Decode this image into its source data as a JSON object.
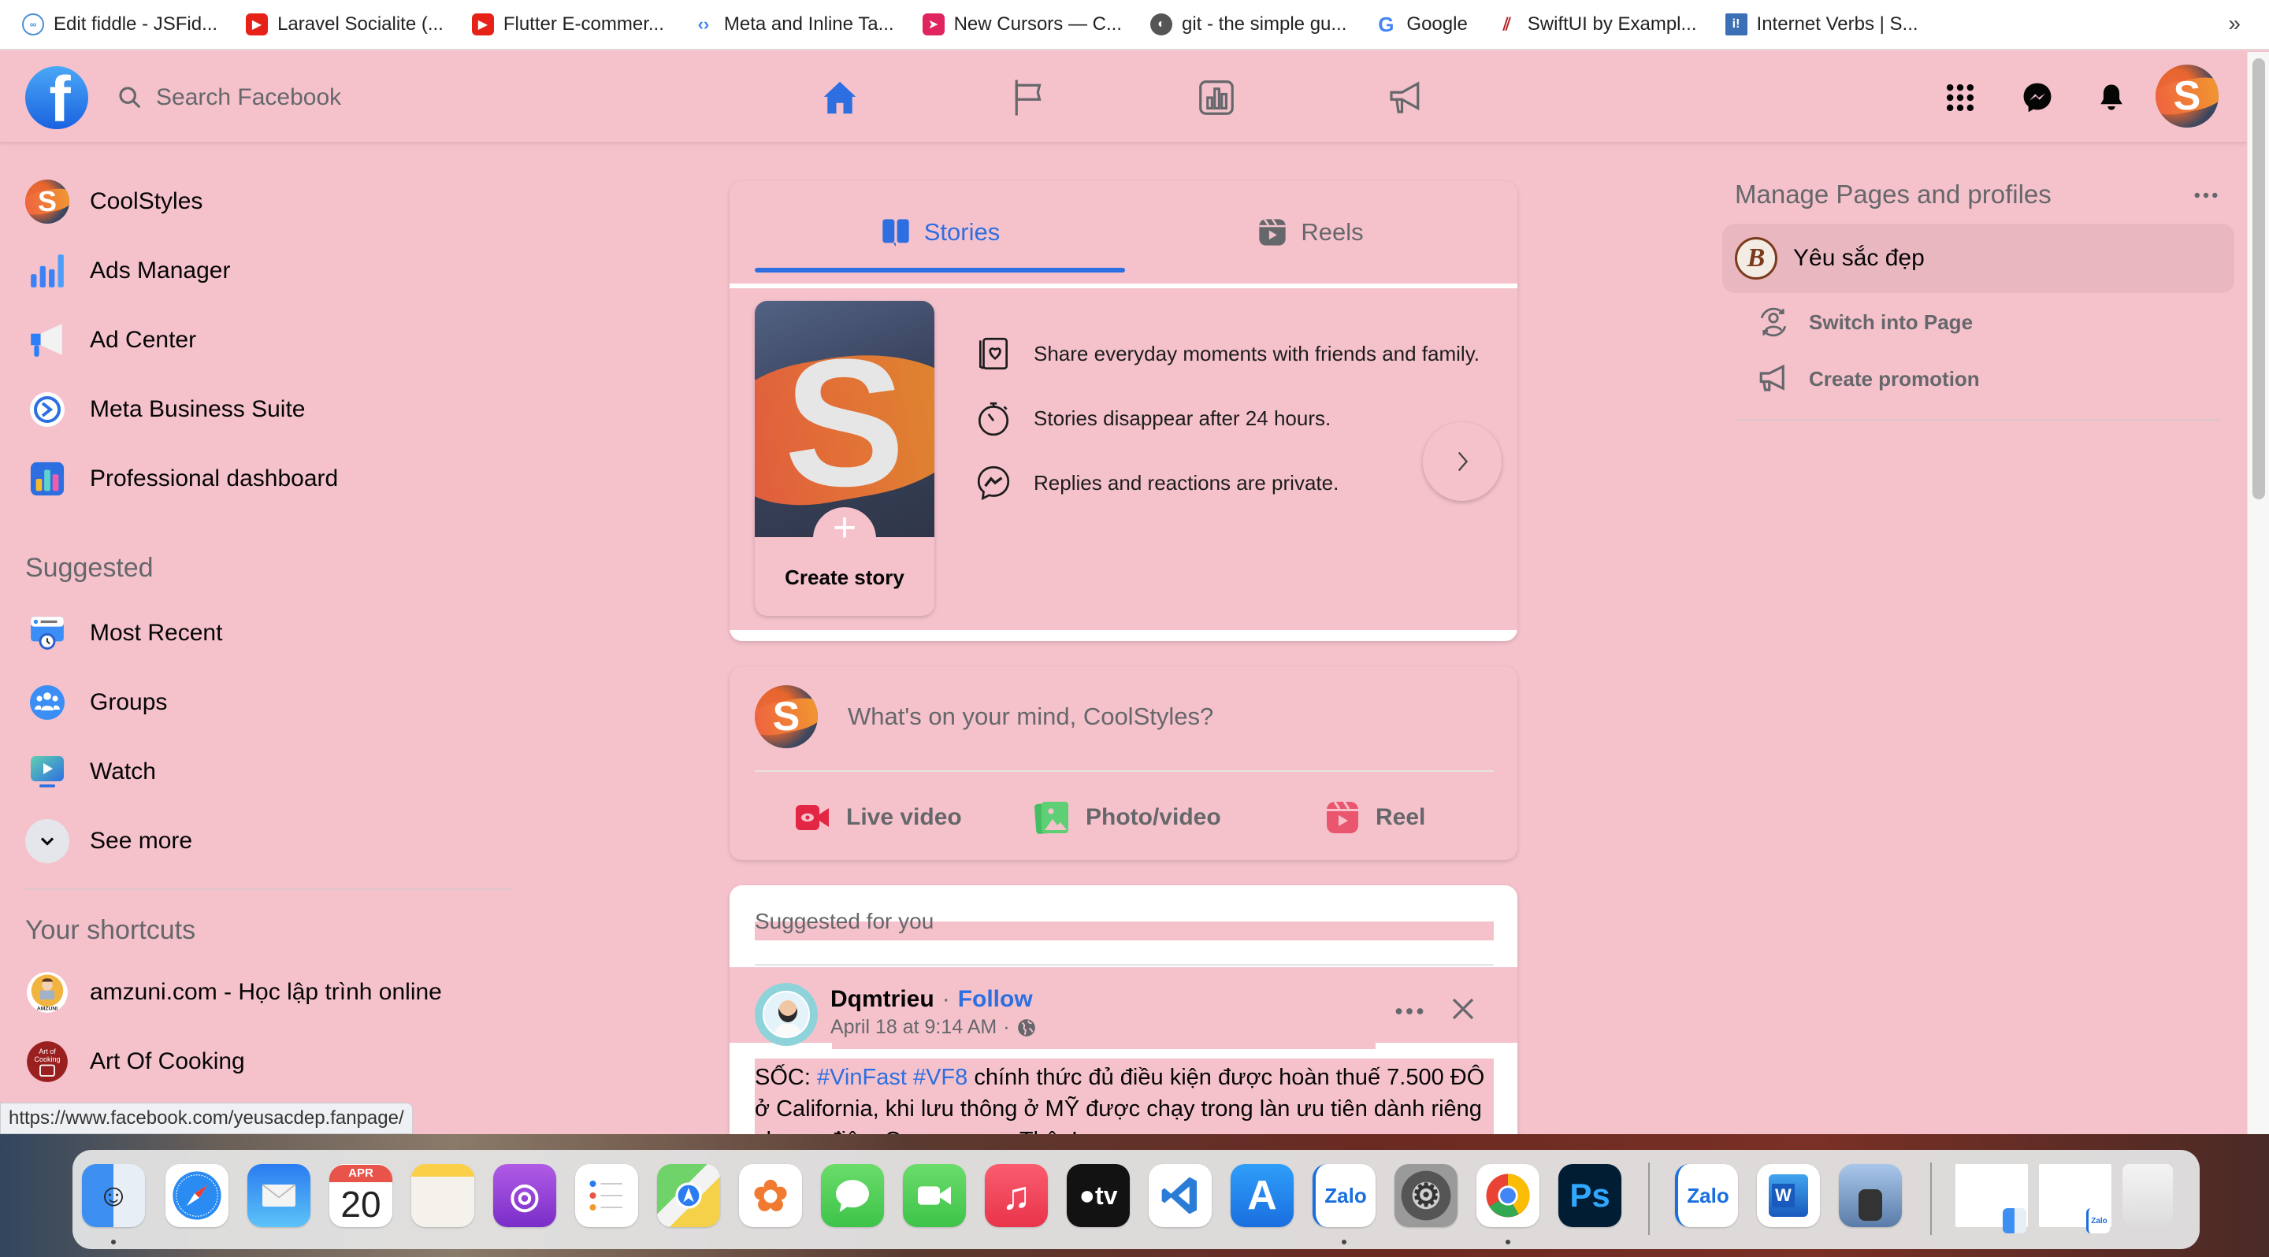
{
  "browser": {
    "bookmarks": [
      {
        "label": "Edit fiddle - JSFid...",
        "icon": "jsfiddle-cloud-icon",
        "color": "#4a90d9"
      },
      {
        "label": "Laravel Socialite (...",
        "icon": "youtube-icon",
        "color": "#e62117"
      },
      {
        "label": "Flutter E-commer...",
        "icon": "youtube-icon",
        "color": "#e62117"
      },
      {
        "label": "Meta and Inline Ta...",
        "icon": "code-tags-icon",
        "color": "#4285f4"
      },
      {
        "label": "New Cursors — C...",
        "icon": "cursor-icon",
        "color": "#e0245e"
      },
      {
        "label": "git - the simple gu...",
        "icon": "git-globe-icon",
        "color": "#555555"
      },
      {
        "label": "Google",
        "icon": "google-icon",
        "color": "#4285f4"
      },
      {
        "label": "SwiftUI by Exampl...",
        "icon": "swiftui-icon",
        "color": "#b22222"
      },
      {
        "label": "Internet Verbs | S...",
        "icon": "internet-verbs-icon",
        "color": "#3b6fb6"
      }
    ],
    "more_bookmarks": "»",
    "status_url": "https://www.facebook.com/yeusacdep.fanpage/"
  },
  "topnav": {
    "logo": "f",
    "search_placeholder": "Search Facebook",
    "center_tabs": [
      {
        "name": "home",
        "icon": "home-icon",
        "active": true
      },
      {
        "name": "pages",
        "icon": "flag-icon",
        "active": false
      },
      {
        "name": "insights",
        "icon": "bar-chart-icon",
        "active": false
      },
      {
        "name": "ad-center",
        "icon": "megaphone-icon",
        "active": false
      }
    ],
    "right_buttons": [
      {
        "name": "menu",
        "icon": "grid-menu-icon"
      },
      {
        "name": "messenger",
        "icon": "messenger-icon"
      },
      {
        "name": "notifications",
        "icon": "bell-icon"
      }
    ],
    "profile_initial": "S"
  },
  "colors": {
    "background": "#f5c2cc",
    "accent": "#2d6fe0",
    "secondary_text": "#65676b",
    "primary_text": "#050505"
  },
  "left_sidebar": {
    "main_items": [
      {
        "label": "CoolStyles",
        "icon": "profile-avatar-icon"
      },
      {
        "label": "Ads Manager",
        "icon": "ads-manager-icon"
      },
      {
        "label": "Ad Center",
        "icon": "ad-center-megaphone-icon"
      },
      {
        "label": "Meta Business Suite",
        "icon": "business-suite-icon"
      },
      {
        "label": "Professional dashboard",
        "icon": "professional-dashboard-icon"
      }
    ],
    "suggested_heading": "Suggested",
    "suggested_items": [
      {
        "label": "Most Recent",
        "icon": "most-recent-icon"
      },
      {
        "label": "Groups",
        "icon": "groups-icon"
      },
      {
        "label": "Watch",
        "icon": "watch-icon"
      },
      {
        "label": "See more",
        "icon": "chevron-down-icon"
      }
    ],
    "shortcuts_heading": "Your shortcuts",
    "shortcuts": [
      {
        "label": "amzuni.com - Học lập trình online",
        "icon": "amzuni-avatar-icon"
      },
      {
        "label": "Art Of Cooking",
        "icon": "art-of-cooking-avatar-icon"
      }
    ]
  },
  "stories": {
    "tabs": [
      {
        "label": "Stories",
        "icon": "stories-book-icon",
        "active": true
      },
      {
        "label": "Reels",
        "icon": "reels-icon",
        "active": false
      }
    ],
    "create_story_label": "Create story",
    "create_story_initial": "S",
    "plus": "+",
    "info": [
      {
        "text": "Share everyday moments with friends and family.",
        "icon": "photo-heart-icon"
      },
      {
        "text": "Stories disappear after 24 hours.",
        "icon": "stopwatch-icon"
      },
      {
        "text": "Replies and reactions are private.",
        "icon": "messenger-outline-icon"
      }
    ]
  },
  "composer": {
    "placeholder": "What's on your mind, CoolStyles?",
    "avatar_initial": "S",
    "actions": [
      {
        "label": "Live video",
        "icon": "live-video-icon",
        "color": "#e42645"
      },
      {
        "label": "Photo/video",
        "icon": "photo-video-icon",
        "color": "#45bd62"
      },
      {
        "label": "Reel",
        "icon": "reel-icon",
        "color": "#e9566e"
      }
    ]
  },
  "feed": {
    "section_label": "Suggested for you",
    "post": {
      "author": "Dqmtrieu",
      "separator": "·",
      "follow_label": "Follow",
      "timestamp": "April 18 at 9:14 AM",
      "privacy_icon": "globe-icon",
      "body_prefix": "SỐC: ",
      "hashtags": [
        "#VinFast",
        "#VF8"
      ],
      "body_rest": " chính thức đủ điều kiện được hoàn thuế 7.500 ĐÔ ở California, khi lưu thông ở MỸ được chạy trong làn ưu tiên dành riêng cho xe điện. Cay cay cay. Thận!"
    }
  },
  "right_sidebar": {
    "heading": "Manage Pages and profiles",
    "page": {
      "name": "Yêu sắc đẹp",
      "avatar_letter": "B"
    },
    "actions": [
      {
        "label": "Switch into Page",
        "icon": "switch-profile-icon"
      },
      {
        "label": "Create promotion",
        "icon": "megaphone-outline-icon"
      }
    ]
  },
  "dock": {
    "apps": [
      {
        "name": "Finder",
        "icon": "finder-icon",
        "running": true
      },
      {
        "name": "Safari",
        "icon": "safari-icon",
        "running": false
      },
      {
        "name": "Mail",
        "icon": "mail-icon",
        "running": false
      },
      {
        "name": "Calendar",
        "icon": "calendar-icon",
        "running": false,
        "month": "APR",
        "day": "20"
      },
      {
        "name": "Notes",
        "icon": "notes-icon",
        "running": false
      },
      {
        "name": "Podcasts",
        "icon": "podcasts-icon",
        "running": false
      },
      {
        "name": "Reminders",
        "icon": "reminders-icon",
        "running": false
      },
      {
        "name": "Maps",
        "icon": "maps-icon",
        "running": false
      },
      {
        "name": "Photos",
        "icon": "photos-icon",
        "running": false
      },
      {
        "name": "Messages",
        "icon": "messages-icon",
        "running": false
      },
      {
        "name": "FaceTime",
        "icon": "facetime-icon",
        "running": false
      },
      {
        "name": "Music",
        "icon": "music-icon",
        "running": false
      },
      {
        "name": "TV",
        "icon": "apple-tv-icon",
        "running": false,
        "label": "tv"
      },
      {
        "name": "Visual Studio Code",
        "icon": "vscode-icon",
        "running": false
      },
      {
        "name": "App Store",
        "icon": "app-store-icon",
        "running": false
      },
      {
        "name": "Zalo",
        "icon": "zalo-icon",
        "running": true,
        "label": "Zalo"
      },
      {
        "name": "System Preferences",
        "icon": "system-preferences-icon",
        "running": false
      },
      {
        "name": "Chrome",
        "icon": "chrome-icon",
        "running": true
      },
      {
        "name": "Photoshop",
        "icon": "photoshop-icon",
        "running": false,
        "label": "Ps"
      }
    ],
    "recent_apps": [
      {
        "name": "Zalo",
        "icon": "zalo-icon",
        "label": "Zalo"
      },
      {
        "name": "Word",
        "icon": "word-icon",
        "label": "W"
      },
      {
        "name": "Preview",
        "icon": "preview-icon"
      }
    ],
    "minimized": [
      {
        "name": "Finder window",
        "icon": "finder-window-thumbnail-icon"
      },
      {
        "name": "Zalo window",
        "icon": "zalo-window-thumbnail-icon"
      }
    ],
    "trash": {
      "name": "Trash",
      "icon": "trash-icon"
    }
  }
}
